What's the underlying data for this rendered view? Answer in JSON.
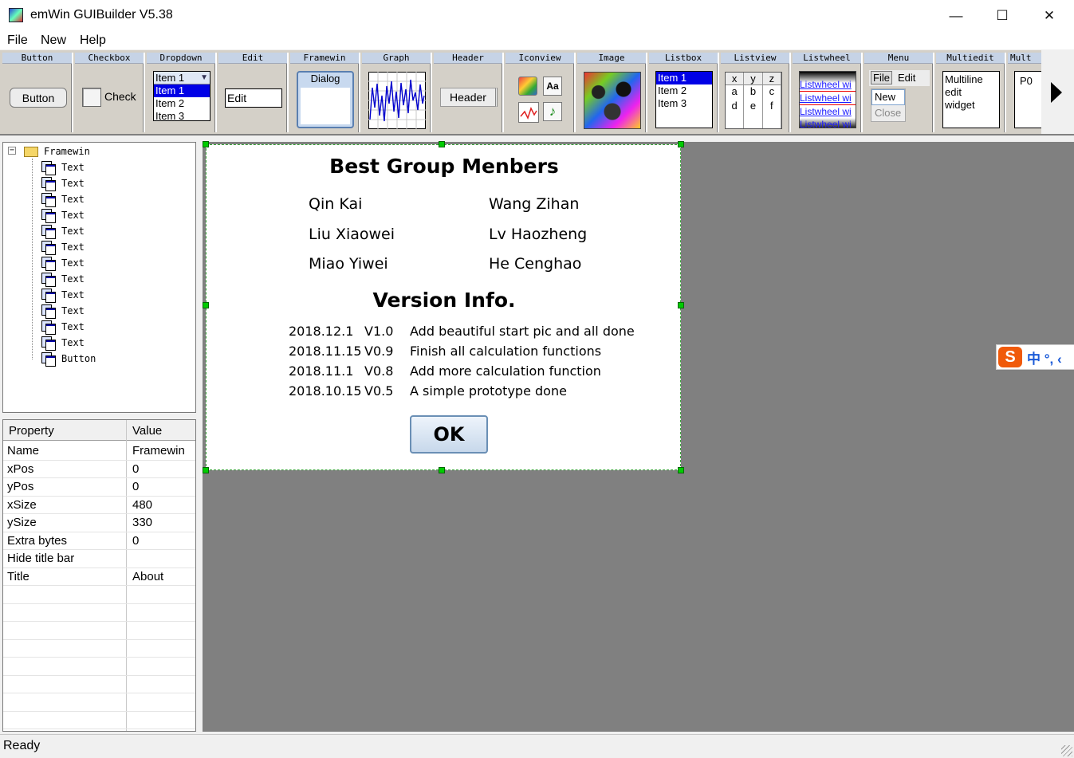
{
  "window": {
    "title": "emWin GUIBuilder V5.38",
    "minimize": "—",
    "maximize": "☐",
    "close": "✕"
  },
  "menu": [
    "File",
    "New",
    "Help"
  ],
  "palette": {
    "button": {
      "header": "Button",
      "label": "Button"
    },
    "checkbox": {
      "header": "Checkbox",
      "label": "Check"
    },
    "dropdown": {
      "header": "Dropdown",
      "selected": "Item 1",
      "items": [
        "Item 1",
        "Item 2",
        "Item 3"
      ]
    },
    "edit": {
      "header": "Edit",
      "value": "Edit"
    },
    "framewin": {
      "header": "Framewin",
      "caption": "Dialog"
    },
    "graph": {
      "header": "Graph"
    },
    "headerwidget": {
      "header": "Header",
      "label": "Header"
    },
    "iconview": {
      "header": "Iconview",
      "icon_text": "Aa",
      "note": "♪"
    },
    "image": {
      "header": "Image"
    },
    "listbox": {
      "header": "Listbox",
      "items": [
        "Item 1",
        "Item 2",
        "Item 3"
      ]
    },
    "listview": {
      "header": "Listview",
      "cols": [
        "x",
        "y",
        "z"
      ],
      "rows": [
        [
          "a",
          "b",
          "c"
        ],
        [
          "d",
          "e",
          "f"
        ]
      ]
    },
    "listwheel": {
      "header": "Listwheel",
      "lines": [
        "Listwheel wi",
        "Listwheel wi",
        "Listwheel wi",
        "Listwheel wi"
      ]
    },
    "menuwidget": {
      "header": "Menu",
      "top": [
        "File",
        "Edit"
      ],
      "items": [
        "New",
        "Close"
      ]
    },
    "multiedit": {
      "header": "Multiedit",
      "lines": [
        "Multiline",
        "edit",
        "widget"
      ]
    },
    "multipage": {
      "header": "Mult",
      "tab": "P0"
    }
  },
  "tree": {
    "root": "Framewin",
    "expander": "−",
    "children": [
      "Text",
      "Text",
      "Text",
      "Text",
      "Text",
      "Text",
      "Text",
      "Text",
      "Text",
      "Text",
      "Text",
      "Text",
      "Button"
    ]
  },
  "properties": {
    "headers": [
      "Property",
      "Value"
    ],
    "rows": [
      [
        "Name",
        "Framewin"
      ],
      [
        "xPos",
        "0"
      ],
      [
        "yPos",
        "0"
      ],
      [
        "xSize",
        "480"
      ],
      [
        "ySize",
        "330"
      ],
      [
        "Extra bytes",
        "0"
      ],
      [
        "Hide title bar",
        ""
      ],
      [
        "Title",
        "About"
      ]
    ]
  },
  "dialog": {
    "title": "Best Group Menbers",
    "members": [
      "Qin Kai",
      "Wang Zihan",
      "Liu Xiaowei",
      "Lv Haozheng",
      "Miao Yiwei",
      "He Cenghao"
    ],
    "version_title": "Version Info.",
    "versions": [
      [
        "2018.12.1",
        "V1.0",
        "Add beautiful start pic and all done"
      ],
      [
        "2018.11.15",
        "V0.9",
        "Finish all calculation functions"
      ],
      [
        "2018.11.1",
        "V0.8",
        "Add more calculation function"
      ],
      [
        "2018.10.15",
        "V0.5",
        "A simple prototype done"
      ]
    ],
    "ok": "OK"
  },
  "ime": {
    "logo": "S",
    "text": "中 °, ‹"
  },
  "status": "Ready"
}
